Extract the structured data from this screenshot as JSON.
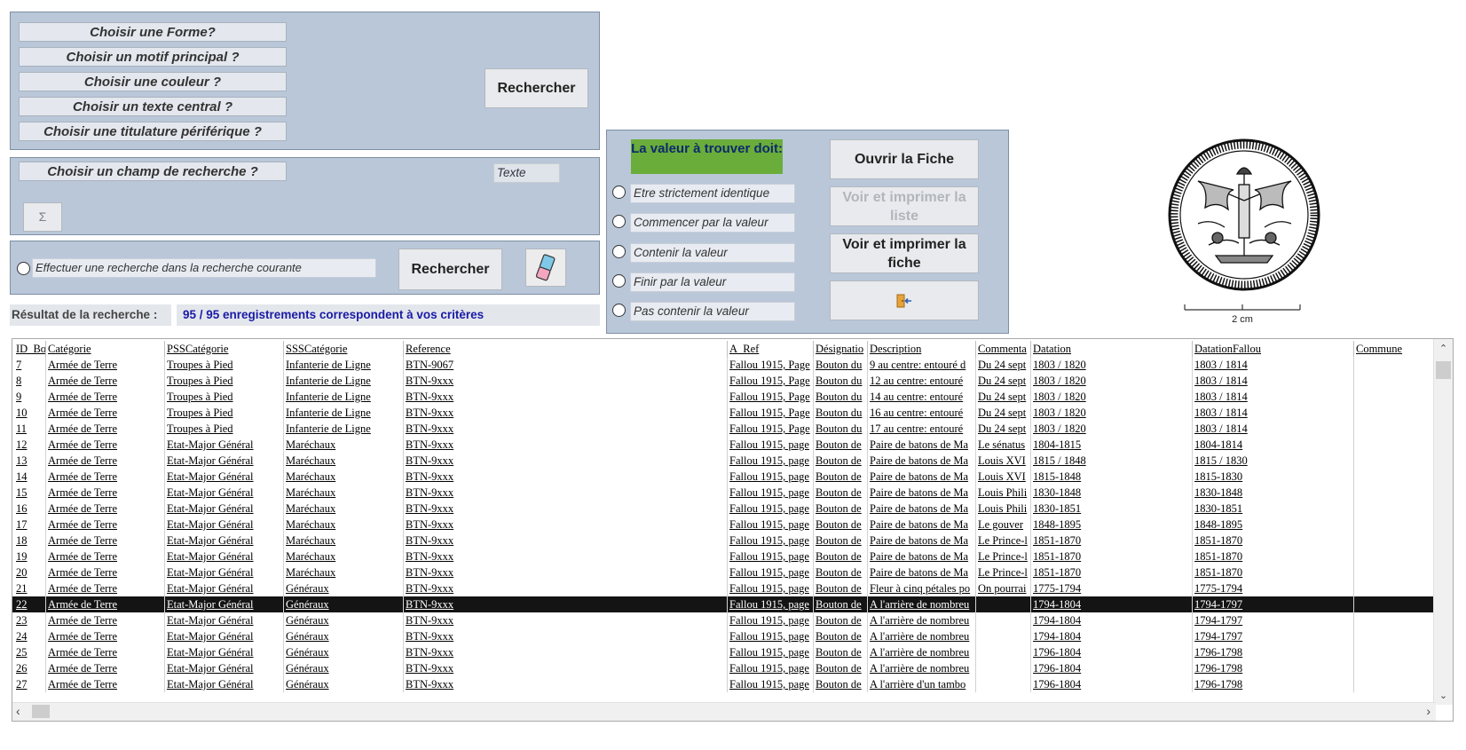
{
  "search_form": {
    "choices": [
      "Choisir une Forme?",
      "Choisir un motif principal ?",
      "Choisir une couleur ?",
      "Choisir un texte central ?",
      "Choisir une titulature périférique ?"
    ],
    "search_button": "Rechercher",
    "field_choice": "Choisir un champ de recherche ?",
    "text_placeholder": "Texte",
    "sigma": "Σ",
    "subsearch_label": "Effectuer une recherche dans la recherche courante",
    "subsearch_button": "Rechercher"
  },
  "result": {
    "label": "Résultat de la recherche :",
    "summary": "95 / 95 enregistrements correspondent à vos critères"
  },
  "match_panel": {
    "title": "La valeur à trouver doit:",
    "options": [
      "Etre strictement identique",
      "Commencer par la valeur",
      "Contenir la valeur",
      "Finir par la valeur",
      "Pas contenir la valeur"
    ],
    "open_sheet": "Ouvrir la Fiche",
    "print_list": "Voir et imprimer la liste",
    "print_sheet": "Voir et imprimer la fiche"
  },
  "image": {
    "scale_label": "2 cm"
  },
  "colors": {
    "panel": "#b9c7d9",
    "green": "#6aad3a",
    "result_blue": "#1a1aa6",
    "selected_row": "#141414"
  },
  "table": {
    "columns": [
      "ID_Bo",
      "Catégorie",
      "PSSCatégorie",
      "SSSCatégorie",
      "Reference",
      "A_Ref",
      "Désignatio",
      "Description",
      "Commenta",
      "Datation",
      "DatationFallou",
      "Commune"
    ],
    "selected_row_index": 15,
    "rows": [
      [
        "7",
        "Armée de Terre",
        "Troupes à Pied",
        "Infanterie de Ligne",
        "BTN-9067",
        "Fallou 1915, Page",
        "Bouton du",
        "9 au centre: entouré d",
        "Du 24 sept",
        "1803 / 1820",
        "1803 / 1814",
        ""
      ],
      [
        "8",
        "Armée de Terre",
        "Troupes à Pied",
        "Infanterie de Ligne",
        "BTN-9xxx",
        "Fallou 1915, Page",
        "Bouton du",
        "12 au centre: entouré",
        "Du 24 sept",
        "1803 / 1820",
        "1803 / 1814",
        ""
      ],
      [
        "9",
        "Armée de Terre",
        "Troupes à Pied",
        "Infanterie de Ligne",
        "BTN-9xxx",
        "Fallou 1915, Page",
        "Bouton du",
        "14 au centre: entouré",
        "Du 24 sept",
        "1803 / 1820",
        "1803 / 1814",
        ""
      ],
      [
        "10",
        "Armée de Terre",
        "Troupes à Pied",
        "Infanterie de Ligne",
        "BTN-9xxx",
        "Fallou 1915, Page",
        "Bouton du",
        "16 au centre: entouré",
        "Du 24 sept",
        "1803 / 1820",
        "1803 / 1814",
        ""
      ],
      [
        "11",
        "Armée de Terre",
        "Troupes à Pied",
        "Infanterie de Ligne",
        "BTN-9xxx",
        "Fallou 1915, Page",
        "Bouton du",
        "17 au centre: entouré",
        "Du 24 sept",
        "1803 / 1820",
        "1803 / 1814",
        ""
      ],
      [
        "12",
        "Armée de Terre",
        "Etat-Major Général",
        "Maréchaux",
        "BTN-9xxx",
        "Fallou 1915, page",
        "Bouton de",
        "Paire de batons de Ma",
        "Le sénatus",
        "1804-1815",
        "1804-1814",
        ""
      ],
      [
        "13",
        "Armée de Terre",
        "Etat-Major Général",
        "Maréchaux",
        "BTN-9xxx",
        "Fallou 1915, page",
        "Bouton de",
        "Paire de batons de Ma",
        "Louis XVI",
        "1815 / 1848",
        "1815 / 1830",
        ""
      ],
      [
        "14",
        "Armée de Terre",
        "Etat-Major Général",
        "Maréchaux",
        "BTN-9xxx",
        "Fallou 1915, page",
        "Bouton de",
        "Paire de batons de Ma",
        "Louis XVI",
        "1815-1848",
        "1815-1830",
        ""
      ],
      [
        "15",
        "Armée de Terre",
        "Etat-Major Général",
        "Maréchaux",
        "BTN-9xxx",
        "Fallou 1915, page",
        "Bouton de",
        "Paire de batons de Ma",
        "Louis Phili",
        "1830-1848",
        "1830-1848",
        ""
      ],
      [
        "16",
        "Armée de Terre",
        "Etat-Major Général",
        "Maréchaux",
        "BTN-9xxx",
        "Fallou 1915, page",
        "Bouton de",
        "Paire de batons de Ma",
        "Louis Phili",
        "1830-1851",
        "1830-1851",
        ""
      ],
      [
        "17",
        "Armée de Terre",
        "Etat-Major Général",
        "Maréchaux",
        "BTN-9xxx",
        "Fallou 1915, page",
        "Bouton de",
        "Paire de batons de Ma",
        "Le gouver",
        "1848-1895",
        "1848-1895",
        ""
      ],
      [
        "18",
        "Armée de Terre",
        "Etat-Major Général",
        "Maréchaux",
        "BTN-9xxx",
        "Fallou 1915, page",
        "Bouton de",
        "Paire de batons de Ma",
        "Le Prince-l",
        "1851-1870",
        "1851-1870",
        ""
      ],
      [
        "19",
        "Armée de Terre",
        "Etat-Major Général",
        "Maréchaux",
        "BTN-9xxx",
        "Fallou 1915, page",
        "Bouton de",
        "Paire de batons de Ma",
        "Le Prince-l",
        "1851-1870",
        "1851-1870",
        ""
      ],
      [
        "20",
        "Armée de Terre",
        "Etat-Major Général",
        "Maréchaux",
        "BTN-9xxx",
        "Fallou 1915, page",
        "Bouton de",
        "Paire de batons de Ma",
        "Le Prince-l",
        "1851-1870",
        "1851-1870",
        ""
      ],
      [
        "21",
        "Armée de Terre",
        "Etat-Major Général",
        "Généraux",
        "BTN-9xxx",
        "Fallou 1915, page",
        "Bouton de",
        "Fleur à cinq pétales po",
        "On pourrai",
        "1775-1794",
        "1775-1794",
        ""
      ],
      [
        "22",
        "Armée de Terre",
        "Etat-Major Général",
        "Généraux",
        "BTN-9xxx",
        "Fallou 1915, page",
        "Bouton de",
        "A l'arrière de nombreu",
        "",
        "1794-1804",
        "1794-1797",
        ""
      ],
      [
        "23",
        "Armée de Terre",
        "Etat-Major Général",
        "Généraux",
        "BTN-9xxx",
        "Fallou 1915, page",
        "Bouton de",
        "A l'arrière de nombreu",
        "",
        "1794-1804",
        "1794-1797",
        ""
      ],
      [
        "24",
        "Armée de Terre",
        "Etat-Major Général",
        "Généraux",
        "BTN-9xxx",
        "Fallou 1915, page",
        "Bouton de",
        "A l'arrière de nombreu",
        "",
        "1794-1804",
        "1794-1797",
        ""
      ],
      [
        "25",
        "Armée de Terre",
        "Etat-Major Général",
        "Généraux",
        "BTN-9xxx",
        "Fallou 1915, page",
        "Bouton de",
        "A l'arrière de nombreu",
        "",
        "1796-1804",
        "1796-1798",
        ""
      ],
      [
        "26",
        "Armée de Terre",
        "Etat-Major Général",
        "Généraux",
        "BTN-9xxx",
        "Fallou 1915, page",
        "Bouton de",
        "A l'arrière de nombreu",
        "",
        "1796-1804",
        "1796-1798",
        ""
      ],
      [
        "27",
        "Armée de Terre",
        "Etat-Major Général",
        "Généraux",
        "BTN-9xxx",
        "Fallou 1915, page",
        "Bouton de",
        "A l'arrière d'un tambo",
        "",
        "1796-1804",
        "1796-1798",
        ""
      ]
    ]
  }
}
